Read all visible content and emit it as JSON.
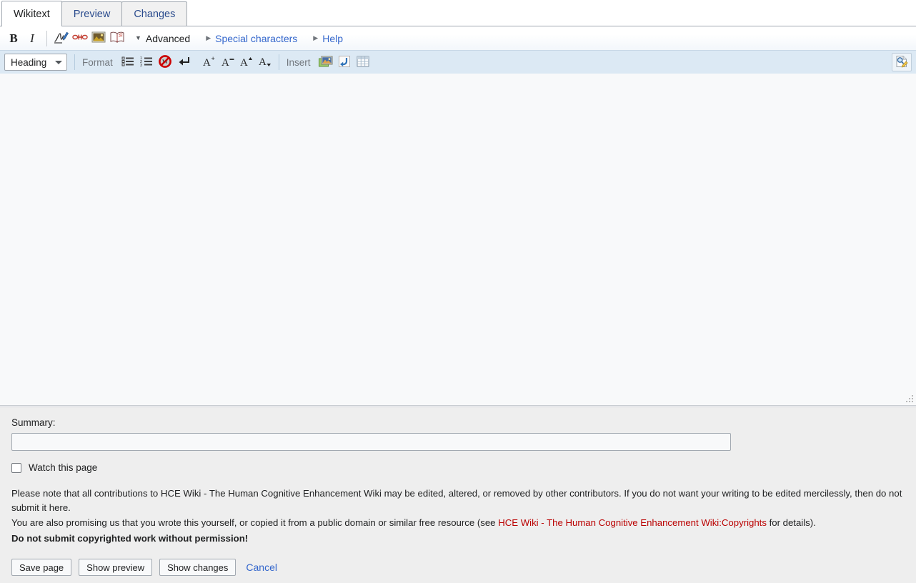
{
  "tabs": [
    {
      "label": "Wikitext",
      "active": true,
      "name": "tab-wikitext"
    },
    {
      "label": "Preview",
      "active": false,
      "name": "tab-preview"
    },
    {
      "label": "Changes",
      "active": false,
      "name": "tab-changes"
    }
  ],
  "toolbar": {
    "row1": {
      "bold_label": "B",
      "italic_label": "I",
      "icons": [
        {
          "name": "signature-icon",
          "title": "Signature and timestamp"
        },
        {
          "name": "link-icon",
          "title": "Link"
        },
        {
          "name": "embedded-file-icon",
          "title": "Embedded file"
        },
        {
          "name": "reference-icon",
          "title": "Reference"
        }
      ],
      "advanced_label": "Advanced",
      "special_characters_label": "Special characters",
      "help_label": "Help"
    },
    "row2": {
      "heading_label": "Heading",
      "format_label": "Format",
      "insert_label": "Insert",
      "format_icons": [
        {
          "name": "bulleted-list-icon",
          "title": "Bulleted list"
        },
        {
          "name": "numbered-list-icon",
          "title": "Numbered list"
        },
        {
          "name": "nowiki-icon",
          "title": "No wiki formatting"
        },
        {
          "name": "newline-icon",
          "title": "New line"
        }
      ],
      "text_size_icons": [
        {
          "name": "big-text-icon",
          "glyph": "A",
          "mark": "+",
          "title": "Big"
        },
        {
          "name": "small-text-icon",
          "glyph": "A",
          "mark": "−",
          "title": "Small"
        },
        {
          "name": "superscript-icon",
          "glyph": "A",
          "mark": "▲",
          "title": "Superscript"
        },
        {
          "name": "subscript-icon",
          "glyph": "A",
          "mark": "▼",
          "title": "Subscript"
        }
      ],
      "insert_icons": [
        {
          "name": "picture-icon",
          "title": "Picture gallery"
        },
        {
          "name": "redirect-icon",
          "title": "Redirect"
        },
        {
          "name": "table-icon",
          "title": "Table"
        }
      ],
      "search_replace": {
        "name": "search-and-replace-icon",
        "title": "Search and replace"
      }
    }
  },
  "editor": {
    "value": "",
    "placeholder": ""
  },
  "footer": {
    "summary_label": "Summary:",
    "summary_value": "",
    "summary_placeholder": "",
    "watch_label": "Watch this page",
    "watch_checked": false,
    "copyright": {
      "line1": "Please note that all contributions to HCE Wiki - The Human Cognitive Enhancement Wiki may be edited, altered, or removed by other contributors. If you do not want your writing to be edited mercilessly, then do not submit it here.",
      "line2_before": "You are also promising us that you wrote this yourself, or copied it from a public domain or similar free resource (see ",
      "line2_link": "HCE Wiki - The Human Cognitive Enhancement Wiki:Copyrights",
      "line2_after": " for details).",
      "line3": "Do not submit copyrighted work without permission!"
    },
    "buttons": [
      {
        "label": "Save page",
        "name": "save-page-button"
      },
      {
        "label": "Show preview",
        "name": "show-preview-button"
      },
      {
        "label": "Show changes",
        "name": "show-changes-button"
      }
    ],
    "cancel_label": "Cancel"
  },
  "colors": {
    "link_blue": "#3366cc",
    "red_link": "#ba0000",
    "toolbar_blue": "#dce9f4",
    "footer_gray": "#eeeeee",
    "border_gray": "#a2a9b1"
  }
}
